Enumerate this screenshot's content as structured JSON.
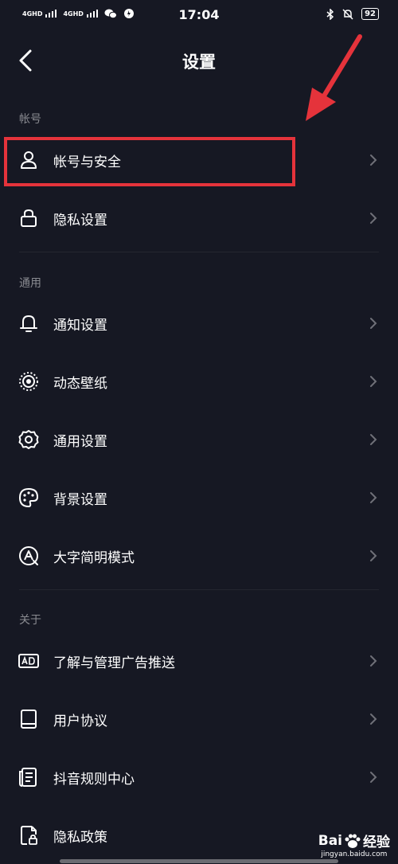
{
  "status_bar": {
    "net1": "4GHD",
    "net2": "4GHD",
    "time": "17:04",
    "battery": "92"
  },
  "header": {
    "title": "设置"
  },
  "sections": {
    "account": "帐号",
    "general": "通用",
    "about": "关于"
  },
  "items": [
    {
      "label": "帐号与安全",
      "icon": "user-icon"
    },
    {
      "label": "隐私设置",
      "icon": "lock-icon"
    },
    {
      "label": "通知设置",
      "icon": "bell-icon"
    },
    {
      "label": "动态壁纸",
      "icon": "live-wallpaper-icon"
    },
    {
      "label": "通用设置",
      "icon": "gear-icon"
    },
    {
      "label": "背景设置",
      "icon": "palette-icon"
    },
    {
      "label": "大字简明模式",
      "icon": "large-font-icon"
    },
    {
      "label": "了解与管理广告推送",
      "icon": "ad-icon"
    },
    {
      "label": "用户协议",
      "icon": "book-icon"
    },
    {
      "label": "抖音规则中心",
      "icon": "document-icon"
    },
    {
      "label": "隐私政策",
      "icon": "privacy-doc-icon"
    }
  ],
  "annotation": {
    "highlight_color": "#e5333b"
  },
  "watermark": {
    "brand_a": "Bai",
    "brand_b": "经验",
    "url": "jingyan.baidu.com"
  },
  "colors": {
    "background": "#161823",
    "text": "#ffffff",
    "section_text": "#8a8b91"
  }
}
